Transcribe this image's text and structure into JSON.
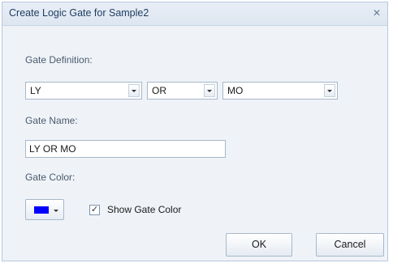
{
  "dialog": {
    "title": "Create Logic Gate for Sample2",
    "close_glyph": "✕"
  },
  "definition": {
    "label": "Gate Definition:",
    "left_operand": "LY",
    "operator": "OR",
    "right_operand": "MO"
  },
  "name": {
    "label": "Gate Name:",
    "value": "LY OR MO"
  },
  "color": {
    "label": "Gate Color:",
    "swatch": "#0000ff",
    "show_label": "Show Gate Color",
    "show_checked": true
  },
  "buttons": {
    "ok": "OK",
    "cancel": "Cancel"
  }
}
